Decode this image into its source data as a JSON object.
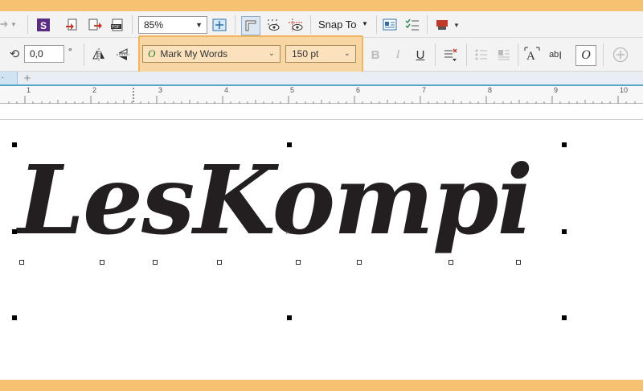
{
  "toolbar": {
    "zoom_value": "85%",
    "snap_label": "Snap To"
  },
  "property_bar": {
    "angle_value": "0,0",
    "angle_unit": "°",
    "font_name": "Mark My Words",
    "font_size": "150 pt"
  },
  "ruler": {
    "labels": [
      "1",
      "2",
      "3",
      "4",
      "5",
      "6",
      "7",
      "8",
      "9",
      "10"
    ]
  },
  "canvas": {
    "text": "LesKompi",
    "text_color": "#231f20"
  },
  "colors": {
    "frame": "#f6c271",
    "highlight": "#f8d6a2",
    "accent_line": "#54a7c9"
  }
}
